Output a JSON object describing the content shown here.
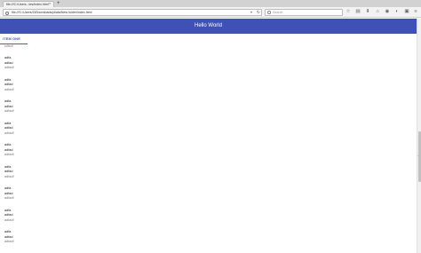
{
  "browser": {
    "tab_title": "file:///C:/Users...tes/index.html",
    "tab_close": "×",
    "new_tab": "+",
    "url": "file:///C:/Users/Zi/Downloads/pliata/New folder/index.html",
    "search_placeholder": "Search",
    "icons": [
      "star-icon",
      "reading-list-icon",
      "download-icon",
      "home-icon",
      "pocket-icon",
      "share-icon",
      "extensions-icon",
      "menu-icon"
    ]
  },
  "app": {
    "title": "Hello World",
    "tab": "ITEM ONE",
    "lead": "sdfsdf",
    "cards": [
      {
        "line1": "adfa",
        "line2": "adfad",
        "line3": "adfadf"
      },
      {
        "line1": "adfa",
        "line2": "adfad",
        "line3": "adfadf"
      },
      {
        "line1": "adfa",
        "line2": "adfad",
        "line3": "adfadf"
      },
      {
        "line1": "adfa",
        "line2": "adfad",
        "line3": "adfadf"
      },
      {
        "line1": "adfa",
        "line2": "adfad",
        "line3": "adfadf"
      },
      {
        "line1": "adfa",
        "line2": "adfad",
        "line3": "adfadf"
      },
      {
        "line1": "adfa",
        "line2": "adfad",
        "line3": "adfadf"
      },
      {
        "line1": "adfa",
        "line2": "adfad",
        "line3": "adfadf"
      },
      {
        "line1": "adfa",
        "line2": "adfad",
        "line3": "adfadf"
      }
    ]
  },
  "colors": {
    "appbar": "#3f51b5",
    "tab_indicator": "#e91e63",
    "tab_text": "#3f51b5"
  }
}
